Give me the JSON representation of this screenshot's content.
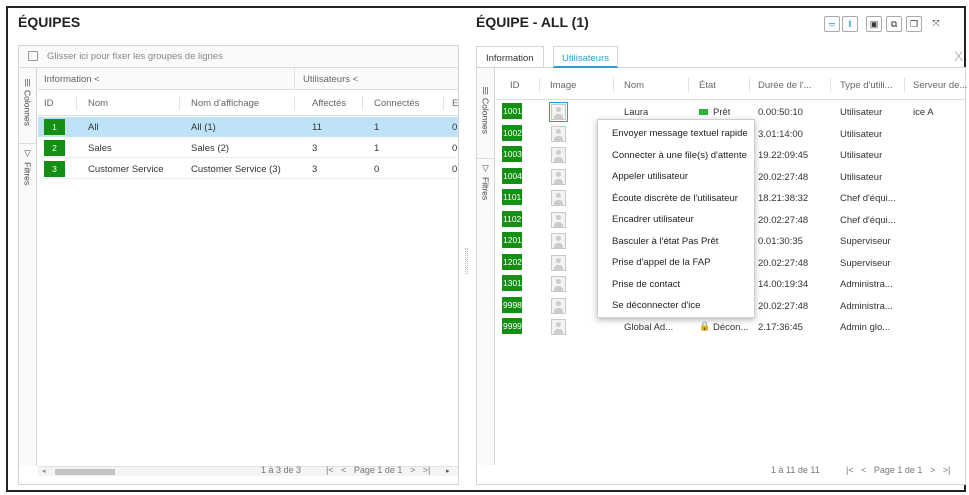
{
  "left": {
    "title": "ÉQUIPES",
    "group_drop_text": "Glisser ici pour fixer les groupes de lignes",
    "side_tabs": {
      "columns": "Colonnes",
      "filters": "Filtres"
    },
    "group_headers": {
      "info": "Information",
      "users": "Utilisateurs"
    },
    "columns": [
      "ID",
      "Nom",
      "Nom d'affichage",
      "Affectés",
      "Connectés",
      "E"
    ],
    "rows": [
      {
        "id": "1",
        "name": "All",
        "display": "All (1)",
        "assigned": "11",
        "connected": "1",
        "extra": "0"
      },
      {
        "id": "2",
        "name": "Sales",
        "display": "Sales (2)",
        "assigned": "3",
        "connected": "1",
        "extra": "0"
      },
      {
        "id": "3",
        "name": "Customer Service",
        "display": "Customer Service (3)",
        "assigned": "3",
        "connected": "0",
        "extra": "0"
      }
    ],
    "pager": {
      "count": "1 à 3 de 3",
      "page": "Page 1 de 1"
    }
  },
  "right": {
    "title": "ÉQUIPE - ALL (1)",
    "toolbar_icons": [
      "equals-icon",
      "pause-icon",
      "save-icon",
      "copy-icon",
      "window-icon",
      "expand-icon"
    ],
    "tabs": [
      "Information",
      "Utilisateurs"
    ],
    "close_glyph": "X",
    "side_tabs": {
      "columns": "Colonnes",
      "filters": "Filtres"
    },
    "columns": [
      "ID",
      "Image",
      "Nom",
      "État",
      "Durée de l'...",
      "Type d'utili...",
      "Serveur de..."
    ],
    "rows": [
      {
        "id": "1001",
        "name": "Laura",
        "state": "Prêt",
        "duration": "0.00:50:10",
        "type": "Utilisateur",
        "server": "ice A"
      },
      {
        "id": "1002",
        "name": "",
        "state": "",
        "duration": "3.01:14:00",
        "type": "Utilisateur",
        "server": ""
      },
      {
        "id": "1003",
        "name": "",
        "state": "",
        "duration": "19.22:09:45",
        "type": "Utilisateur",
        "server": ""
      },
      {
        "id": "1004",
        "name": "",
        "state": "",
        "duration": "20.02:27:48",
        "type": "Utilisateur",
        "server": ""
      },
      {
        "id": "1101",
        "name": "",
        "state": "",
        "duration": "18.21:38:32",
        "type": "Chef d'équi...",
        "server": ""
      },
      {
        "id": "1102",
        "name": "",
        "state": "",
        "duration": "20.02:27:48",
        "type": "Chef d'équi...",
        "server": ""
      },
      {
        "id": "1201",
        "name": "",
        "state": "",
        "duration": "0.01:30:35",
        "type": "Superviseur",
        "server": ""
      },
      {
        "id": "1202",
        "name": "",
        "state": "",
        "duration": "20.02:27:48",
        "type": "Superviseur",
        "server": ""
      },
      {
        "id": "1301",
        "name": "",
        "state": "",
        "duration": "14.00:19:34",
        "type": "Administra...",
        "server": ""
      },
      {
        "id": "9998",
        "name": "",
        "state": "",
        "duration": "20.02:27:48",
        "type": "Administra...",
        "server": ""
      },
      {
        "id": "9999",
        "name": "Global Ad...",
        "state": "Décon...",
        "duration": "2.17:36:45",
        "type": "Admin glo...",
        "server": ""
      }
    ],
    "pager": {
      "count": "1 à 11 de 11",
      "page": "Page 1 de 1"
    }
  },
  "context_menu": [
    "Envoyer message textuel rapide",
    "Connecter à une file(s) d'attente",
    "Appeler utilisateur",
    "Écoute discrète de l'utilisateur",
    "Encadrer utilisateur",
    "Basculer à l'état Pas Prêt",
    "Prise d'appel de la FAP",
    "Prise de contact",
    "Se déconnecter d'ice"
  ],
  "colors": {
    "accent": "#2a9fd6",
    "id_green": "#138f13",
    "selected_row": "#bee3f8",
    "ready": "#26b73a"
  }
}
